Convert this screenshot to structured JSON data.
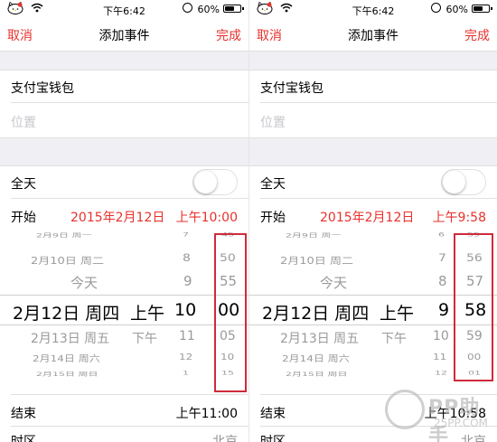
{
  "screens": [
    {
      "status": {
        "time": "下午6:42",
        "battery": "60%",
        "battery_level": 0.6
      },
      "nav": {
        "cancel": "取消",
        "title": "添加事件",
        "done": "完成"
      },
      "event": {
        "title": "支付宝钱包",
        "location_placeholder": "位置"
      },
      "all_day": {
        "label": "全天",
        "on": false
      },
      "start": {
        "label": "开始",
        "date": "2015年2月12日",
        "time": "上午10:00"
      },
      "picker": {
        "dates": [
          "2月9日 周一",
          "2月10日 周二",
          "今天",
          "2月12日 周四",
          "2月13日 周五",
          "2月14日 周六",
          "2月15日 周日"
        ],
        "ampm": [
          "",
          "",
          "",
          "上午",
          "下午",
          "",
          ""
        ],
        "hours": [
          "7",
          "8",
          "9",
          "10",
          "11",
          "12",
          "1"
        ],
        "minutes": [
          "45",
          "50",
          "55",
          "00",
          "05",
          "10",
          "15"
        ]
      },
      "end": {
        "label": "结束",
        "value": "上午11:00"
      },
      "timezone": {
        "label": "时区",
        "value": "北京"
      }
    },
    {
      "status": {
        "time": "下午6:42",
        "battery": "60%",
        "battery_level": 0.6
      },
      "nav": {
        "cancel": "取消",
        "title": "添加事件",
        "done": "完成"
      },
      "event": {
        "title": "支付宝钱包",
        "location_placeholder": "位置"
      },
      "all_day": {
        "label": "全天",
        "on": false
      },
      "start": {
        "label": "开始",
        "date": "2015年2月12日",
        "time": "上午9:58"
      },
      "picker": {
        "dates": [
          "2月9日 周一",
          "2月10日 周二",
          "今天",
          "2月12日 周四",
          "2月13日 周五",
          "2月14日 周六",
          "2月15日 周日"
        ],
        "ampm": [
          "",
          "",
          "",
          "上午",
          "下午",
          "",
          ""
        ],
        "hours": [
          "6",
          "7",
          "8",
          "9",
          "10",
          "11",
          "12"
        ],
        "minutes": [
          "55",
          "56",
          "57",
          "58",
          "59",
          "00",
          "01"
        ]
      },
      "end": {
        "label": "结束",
        "value": "上午10:58"
      },
      "timezone": {
        "label": "时区",
        "value": "北京"
      }
    }
  ],
  "watermark": {
    "text": "PP助手",
    "sub": "25PP.COM"
  },
  "colors": {
    "accent": "#e8312c",
    "highlight_box": "#cf2a3b",
    "group_bg": "#efeff4"
  }
}
